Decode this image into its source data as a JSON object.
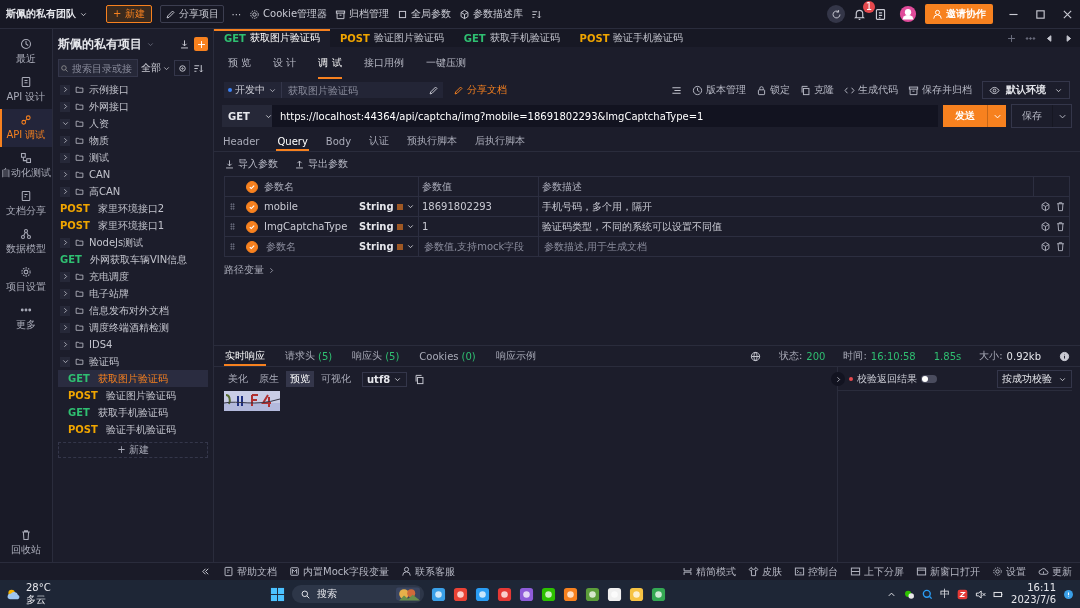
{
  "topbar": {
    "team": "斯佩的私有团队",
    "new_button": "+ 新建",
    "share_button": "分享项目",
    "more": "···",
    "menu": [
      "Cookie管理器",
      "归档管理",
      "全局参数",
      "参数描述库"
    ],
    "notification_count": "1",
    "invite_button": "邀请协作"
  },
  "nav": {
    "items": [
      {
        "label": "最近",
        "selected": false
      },
      {
        "label": "API 设计",
        "selected": false
      },
      {
        "label": "API 调试",
        "selected": true
      },
      {
        "label": "自动化测试",
        "selected": false
      },
      {
        "label": "文档分享",
        "selected": false
      },
      {
        "label": "数据模型",
        "selected": false
      },
      {
        "label": "项目设置",
        "selected": false
      },
      {
        "label": "更多",
        "selected": false
      }
    ],
    "trash": "回收站"
  },
  "tree": {
    "title": "斯佩的私有项目",
    "search_placeholder": "搜索目录或接",
    "filter": "全部",
    "new_button": "+ 新建",
    "items": [
      {
        "kind": "folder",
        "label": "示例接口",
        "expanded": false
      },
      {
        "kind": "folder",
        "label": "外网接口",
        "expanded": false
      },
      {
        "kind": "folder",
        "label": "人资",
        "expanded": true
      },
      {
        "kind": "folder",
        "label": "物质",
        "expanded": false
      },
      {
        "kind": "folder",
        "label": "测试",
        "expanded": false
      },
      {
        "kind": "folder",
        "label": "CAN",
        "expanded": false
      },
      {
        "kind": "folder",
        "label": "高CAN",
        "expanded": false
      },
      {
        "kind": "api",
        "method": "POST",
        "label": "家里环境接口2",
        "selected": false
      },
      {
        "kind": "api",
        "method": "POST",
        "label": "家里环境接口1",
        "selected": false
      },
      {
        "kind": "folder",
        "label": "NodeJs测试",
        "expanded": false
      },
      {
        "kind": "api",
        "method": "GET",
        "label": "外网获取车辆VIN信息",
        "selected": false
      },
      {
        "kind": "folder",
        "label": "充电调度",
        "expanded": false
      },
      {
        "kind": "folder",
        "label": "电子站牌",
        "expanded": false
      },
      {
        "kind": "folder",
        "label": "信息发布对外文档",
        "expanded": false
      },
      {
        "kind": "folder",
        "label": "调度终端酒精检测",
        "expanded": false
      },
      {
        "kind": "folder",
        "label": "IDS4",
        "expanded": false
      },
      {
        "kind": "folder",
        "label": "验证码",
        "expanded": true,
        "children": [
          {
            "kind": "api",
            "method": "GET",
            "label": "获取图片验证码",
            "selected": true
          },
          {
            "kind": "api",
            "method": "POST",
            "label": "验证图片验证码",
            "selected": false
          },
          {
            "kind": "api",
            "method": "GET",
            "label": "获取手机验证码",
            "selected": false
          },
          {
            "kind": "api",
            "method": "POST",
            "label": "验证手机验证码",
            "selected": false
          }
        ]
      }
    ]
  },
  "tabs": [
    {
      "method": "GET",
      "label": "获取图片验证码",
      "selected": true
    },
    {
      "method": "POST",
      "label": "验证图片验证码",
      "selected": false
    },
    {
      "method": "GET",
      "label": "获取手机验证码",
      "selected": false
    },
    {
      "method": "POST",
      "label": "验证手机验证码",
      "selected": false
    }
  ],
  "subtabs": [
    {
      "label": "预 览",
      "selected": false
    },
    {
      "label": "设 计",
      "selected": false
    },
    {
      "label": "调 试",
      "selected": true
    },
    {
      "label": "接口用例",
      "selected": false
    },
    {
      "label": "一键压测",
      "selected": false
    }
  ],
  "toolbar": {
    "status": "开发中",
    "name_placeholder": "获取图片验证码",
    "share_doc": "分享文档",
    "actions": [
      "版本管理",
      "锁定",
      "克隆",
      "生成代码",
      "保存并归档"
    ],
    "environment": "默认环境"
  },
  "request": {
    "method": "GET",
    "url": "https://localhost:44364/api/captcha/img?mobile=18691802293&ImgCaptchaType=1",
    "send_button": "发送",
    "save_button": "保存"
  },
  "request_tabs": [
    {
      "label": "Header",
      "selected": false
    },
    {
      "label": "Query",
      "selected": true
    },
    {
      "label": "Body",
      "selected": false
    },
    {
      "label": "认证",
      "selected": false
    },
    {
      "label": "预执行脚本",
      "selected": false
    },
    {
      "label": "后执行脚本",
      "selected": false
    }
  ],
  "param_tools": [
    "导入参数",
    "导出参数"
  ],
  "params": {
    "header_checked": true,
    "columns": [
      "参数名",
      "参数值",
      "参数描述"
    ],
    "rows": [
      {
        "kind": "param",
        "checked": true,
        "name": "mobile",
        "type": "String",
        "value": "18691802293",
        "description": "手机号码，多个用，隔开"
      },
      {
        "kind": "param",
        "checked": true,
        "name": "ImgCaptchaType",
        "type": "String",
        "value": "1",
        "description": "验证码类型，不同的系统可以设置不同值"
      },
      {
        "kind": "empty",
        "checked": true,
        "name_placeholder": "参数名",
        "type": "String",
        "value_placeholder": "参数值,支持mock字段",
        "description_placeholder": "参数描述,用于生成文档"
      }
    ]
  },
  "path_variables": "路径变量",
  "response": {
    "tabs": [
      {
        "label": "实时响应",
        "selected": true
      },
      {
        "label": "请求头",
        "count": "(5)",
        "selected": false
      },
      {
        "label": "响应头",
        "count": "(5)",
        "selected": false
      },
      {
        "label": "Cookies",
        "count": "(0)",
        "selected": false
      },
      {
        "label": "响应示例",
        "selected": false
      }
    ],
    "stats": [
      {
        "label": "状态:",
        "value": "200",
        "kind": "ok"
      },
      {
        "label": "时间:",
        "value": "16:10:58",
        "kind": "ok"
      },
      {
        "value": "1.85s",
        "kind": "ok"
      },
      {
        "label": "大小:",
        "value": "0.92kb",
        "kind": "plain"
      }
    ],
    "view_modes": [
      {
        "label": "美化",
        "selected": false
      },
      {
        "label": "原生",
        "selected": false
      },
      {
        "label": "预览",
        "selected": true
      },
      {
        "label": "可视化",
        "selected": false
      }
    ],
    "encoding": "utf8",
    "check_label": "校验返回结果",
    "check_on": false,
    "check_mode": "按成功校验"
  },
  "status_bar": {
    "left": [
      "帮助文档",
      "内置Mock字段变量",
      "联系客服"
    ],
    "right": [
      "精简模式",
      "皮肤",
      "控制台",
      "上下分屏",
      "新窗口打开",
      "设置",
      "更新"
    ]
  },
  "taskbar": {
    "temperature": "28°C",
    "weather": "多云",
    "search": "搜索",
    "ime": "中",
    "time": "16:11",
    "date": "2023/7/6"
  }
}
